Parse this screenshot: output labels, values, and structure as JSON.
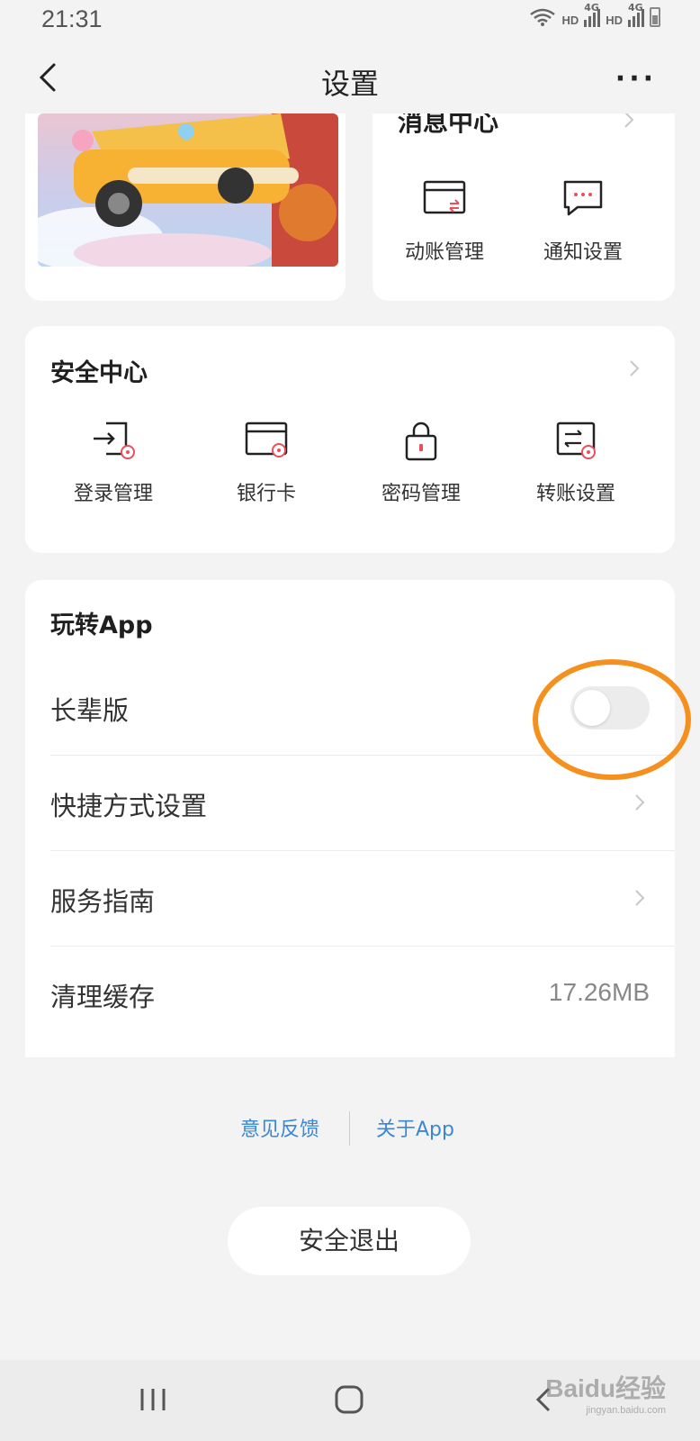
{
  "status_bar": {
    "time": "21:31",
    "network_1": "HD",
    "network_1_gen": "4G",
    "network_2": "HD",
    "network_2_gen": "4G"
  },
  "header": {
    "title": "设置",
    "more_label": "···"
  },
  "message_center": {
    "title": "消息中心",
    "items": [
      {
        "label": "动账管理",
        "icon": "card-transfer-icon"
      },
      {
        "label": "通知设置",
        "icon": "chat-bubble-icon"
      }
    ]
  },
  "security_center": {
    "title": "安全中心",
    "items": [
      {
        "label": "登录管理",
        "icon": "login-arrow-icon"
      },
      {
        "label": "银行卡",
        "icon": "bank-card-icon"
      },
      {
        "label": "密码管理",
        "icon": "lock-icon"
      },
      {
        "label": "转账设置",
        "icon": "transfer-icon"
      }
    ]
  },
  "play_app": {
    "title": "玩转App",
    "rows": [
      {
        "label": "长辈版",
        "type": "toggle",
        "on": false
      },
      {
        "label": "快捷方式设置",
        "type": "chevron"
      },
      {
        "label": "服务指南",
        "type": "chevron"
      },
      {
        "label": "清理缓存",
        "type": "value",
        "value": "17.26MB"
      }
    ]
  },
  "footer_links": {
    "feedback": "意见反馈",
    "about": "关于App"
  },
  "logout": {
    "label": "安全退出"
  },
  "watermark": {
    "brand": "Baidu经验",
    "url": "jingyan.baidu.com"
  },
  "colors": {
    "link": "#3a87d4",
    "highlight": "#f5901e",
    "icon_accent": "#e8505b"
  }
}
